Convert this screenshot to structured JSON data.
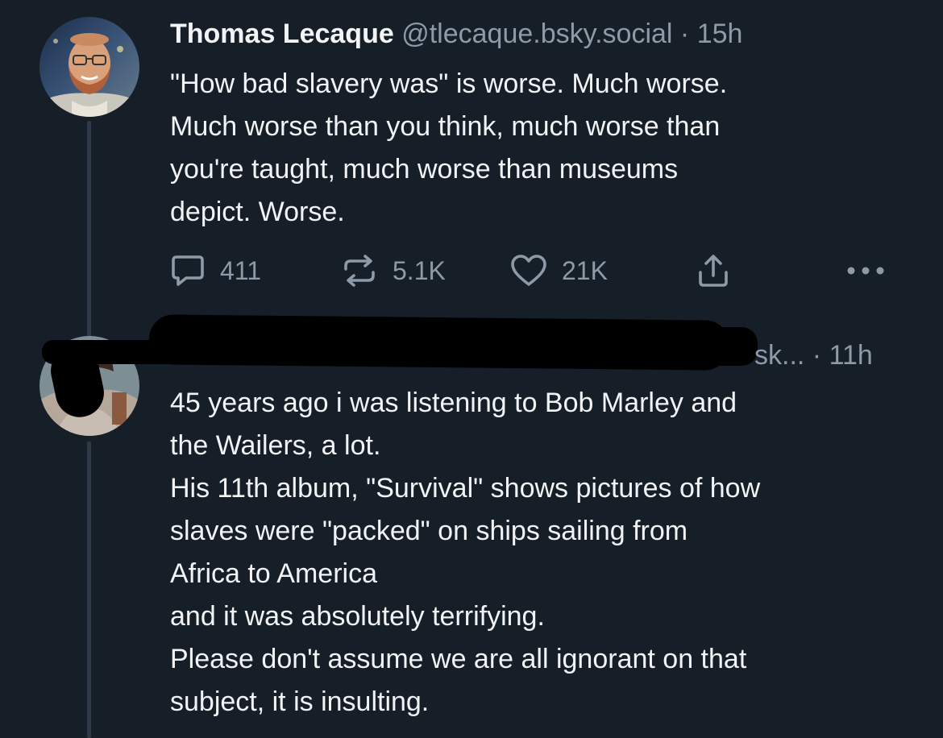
{
  "posts": [
    {
      "author_name": "Thomas Lecaque",
      "handle": "@tlecaque.bsky.social",
      "separator": "·",
      "time": "15h",
      "text": "\"How bad slavery was\" is worse. Much worse.\nMuch worse than you think, much worse than\nyou're taught, much worse than museums\ndepict. Worse.",
      "actions": {
        "reply_count": "411",
        "repost_count": "5.1K",
        "like_count": "21K",
        "share_icon": "share-icon",
        "more_icon": "more-icon"
      }
    },
    {
      "handle_visible_fragment": "sk...",
      "separator": "·",
      "time": "11h",
      "text": "45 years ago i was listening to Bob Marley and\nthe Wailers, a lot.\nHis 11th album, \"Survival\" shows pictures of how\nslaves were \"packed\" on ships sailing from\nAfrica to America\nand it was absolutely terrifying.\nPlease don't assume we are all ignorant on that\nsubject, it is insulting."
    }
  ],
  "colors": {
    "background": "#161e27",
    "text_primary": "#f1f3f5",
    "text_secondary": "#8d9aa8",
    "thread_line": "#2e3a48"
  }
}
